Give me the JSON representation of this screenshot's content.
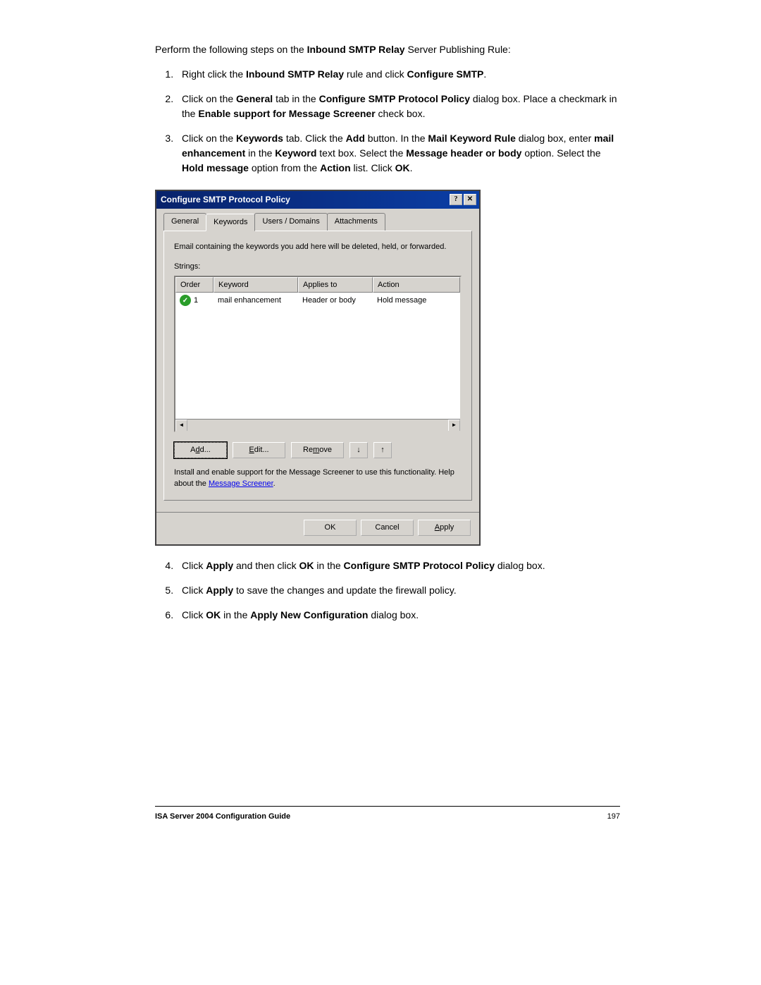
{
  "intro": "Perform the following steps on the",
  "intro_bold": "Inbound SMTP Relay",
  "intro_tail": "Server Publishing Rule:",
  "steps": {
    "s1": {
      "pre": "Right click the ",
      "b1": "Inbound SMTP Relay",
      "mid": " rule and click ",
      "b2": "Configure SMTP",
      "end": "."
    },
    "s2": {
      "pre": "Click on the ",
      "b1": "General",
      "mid": " tab in the ",
      "b2": "Configure SMTP Protocol Policy",
      "post": " dialog box. Place a checkmark in the ",
      "b3": "Enable support for Message Screener",
      "end": " check box."
    },
    "s3": {
      "pre": "Click on the ",
      "b1": "Keywords",
      "mid": " tab. Click the ",
      "b2": "Add",
      "post": " button. In the ",
      "b3": "Mail Keyword Rule",
      "p2": " dialog box, enter ",
      "b4": "mail enhancement",
      "p3": " in the ",
      "b5": "Keyword",
      "p4": " text box. Select the ",
      "b6": "Message header or body",
      "p5": " option. Select the ",
      "b7": "Hold message",
      "p6": " option from the ",
      "b8": "Action",
      "p7": " list. Click ",
      "b9": "OK",
      "end": "."
    },
    "s4": {
      "pre": "Click ",
      "b1": "Apply",
      "mid": " and then click ",
      "b2": "OK",
      "post": " in the ",
      "b3": "Configure SMTP Protocol Policy",
      "end": " dialog box."
    },
    "s5": {
      "pre": "Click ",
      "b1": "Apply",
      "end": " to save the changes and update the firewall policy."
    },
    "s6": {
      "pre": "Click ",
      "b1": "OK",
      "mid": " in the ",
      "b2": "Apply New Configuration",
      "end": " dialog box."
    }
  },
  "dialog": {
    "title": "Configure SMTP Protocol Policy",
    "tabs": {
      "general": "General",
      "keywords": "Keywords",
      "users": "Users / Domains",
      "attachments": "Attachments"
    },
    "desc": "Email containing the keywords you add here will be deleted, held, or forwarded.",
    "strings_label": "Strings:",
    "cols": {
      "order": "Order",
      "keyword": "Keyword",
      "applies": "Applies to",
      "action": "Action"
    },
    "row": {
      "order": "1",
      "keyword": "mail enhancement",
      "applies": "Header or body",
      "action": "Hold message"
    },
    "buttons": {
      "add": "Add...",
      "edit": "Edit...",
      "remove": "Remove"
    },
    "footnote_pre": "Install and enable support for the Message Screener to use this functionality. Help about the ",
    "footnote_link": "Message Screener",
    "footer": {
      "ok": "OK",
      "cancel": "Cancel",
      "apply": "Apply"
    }
  },
  "footer": {
    "title": "ISA Server 2004 Configuration Guide",
    "page": "197"
  }
}
